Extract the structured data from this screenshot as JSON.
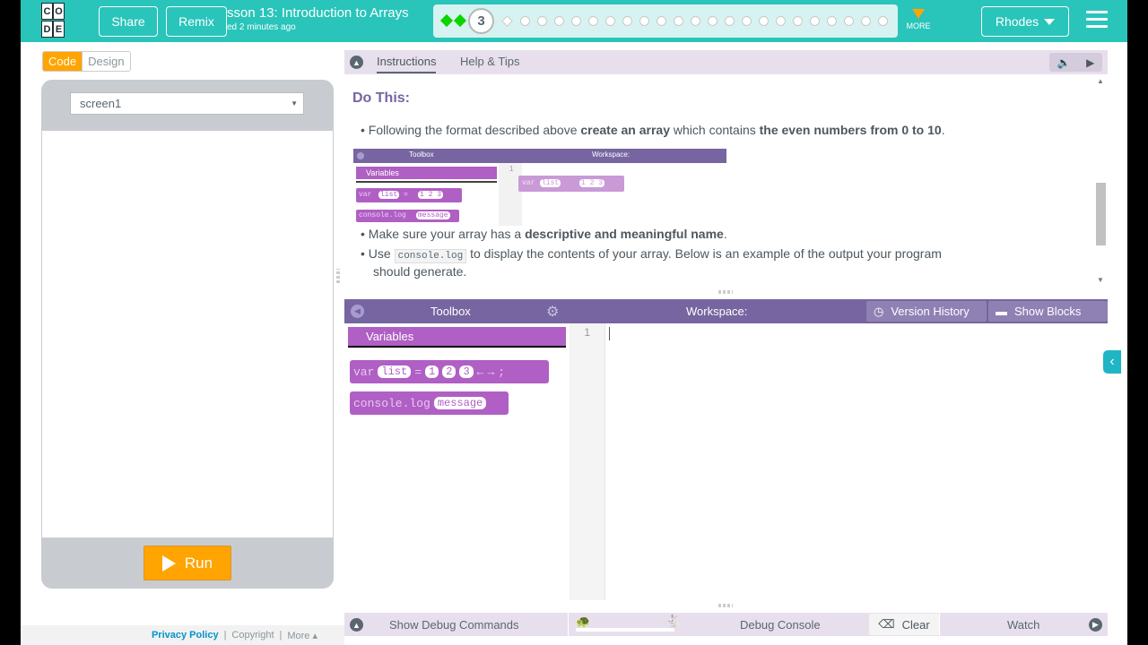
{
  "header": {
    "logo_letters": [
      "C",
      "O",
      "D",
      "E"
    ],
    "share_label": "Share",
    "remix_label": "Remix",
    "lesson_title": "sson 13: Introduction to Arrays",
    "saved_text": "ed 2 minutes ago",
    "current_level": "3",
    "more_label": "MORE",
    "user_name": "Rhodes",
    "brand_color": "#29c4ba"
  },
  "left_panel": {
    "code_tab": "Code",
    "design_tab": "Design",
    "screen_select": "screen1",
    "run_label": "Run"
  },
  "footer": {
    "privacy": "Privacy Policy",
    "sep1": "|",
    "copyright": "Copyright",
    "sep2": "|",
    "more": "More ▴"
  },
  "instructions": {
    "tab_instructions": "Instructions",
    "tab_help": "Help & Tips",
    "heading": "Do This:",
    "bullet1_pre": "Following the format described above ",
    "bullet1_b1": "create an array",
    "bullet1_mid": " which contains ",
    "bullet1_b2": "the even numbers from 0 to 10",
    "bullet1_end": ".",
    "bullet2_pre": "Make sure your array has a ",
    "bullet2_b": "descriptive and meaningful name",
    "bullet2_end": ".",
    "bullet3_pre": "Use ",
    "bullet3_code": "console.log",
    "bullet3_post": " to display the contents of your array. Below is an example of the output your program",
    "bullet3_line2": "should generate.",
    "image": {
      "toolbox": "Toolbox",
      "workspace": "Workspace:",
      "variables": "Variables",
      "line_no": "1",
      "var_kw": "var",
      "list_name": "list",
      "eq": "=",
      "vals": "1 2 3",
      "console": "console.log",
      "message": "message"
    }
  },
  "toolbox": {
    "title": "Toolbox",
    "category": "Variables",
    "block_var": {
      "kw": "var",
      "name": "list",
      "eq": "=",
      "v1": "1",
      "v2": "2",
      "v3": "3",
      "end": ";"
    },
    "block_console": {
      "fn": "console.log",
      "arg": "message"
    }
  },
  "workspace": {
    "title": "Workspace:",
    "version_history": "Version History",
    "show_blocks": "Show Blocks",
    "line_number": "1"
  },
  "debug": {
    "show_commands": "Show Debug Commands",
    "console": "Debug Console",
    "clear": "Clear",
    "watch": "Watch"
  },
  "colors": {
    "accent_purple": "#7665a0",
    "block_purple": "#b05fc4",
    "run_orange": "#ffa400",
    "progress_green": "#0dd300"
  }
}
